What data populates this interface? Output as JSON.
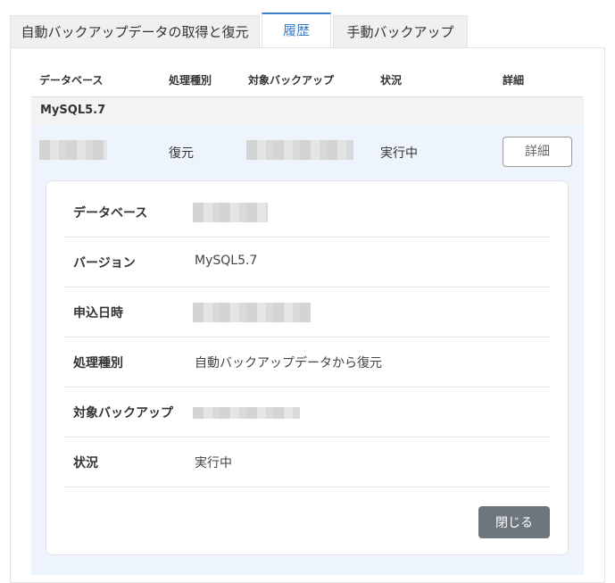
{
  "tabs": [
    {
      "label": "自動バックアップデータの取得と復元"
    },
    {
      "label": "履歴"
    },
    {
      "label": "手動バックアップ"
    }
  ],
  "table": {
    "columns": [
      "データベース",
      "処理種別",
      "対象バックアップ",
      "状況",
      "詳細"
    ],
    "group": "MySQL5.7",
    "row": {
      "type": "復元",
      "status": "実行中",
      "detail_button": "詳細"
    }
  },
  "detail": {
    "rows": [
      {
        "label": "データベース",
        "value": ""
      },
      {
        "label": "バージョン",
        "value": "MySQL5.7"
      },
      {
        "label": "申込日時",
        "value": ""
      },
      {
        "label": "処理種別",
        "value": "自動バックアップデータから復元"
      },
      {
        "label": "対象バックアップ",
        "value": ""
      },
      {
        "label": "状況",
        "value": "実行中"
      }
    ],
    "close_button": "閉じる"
  },
  "colors": {
    "accent": "#3b7ec6",
    "row_highlight": "#eef4fb",
    "close_button": "#6d757d"
  }
}
